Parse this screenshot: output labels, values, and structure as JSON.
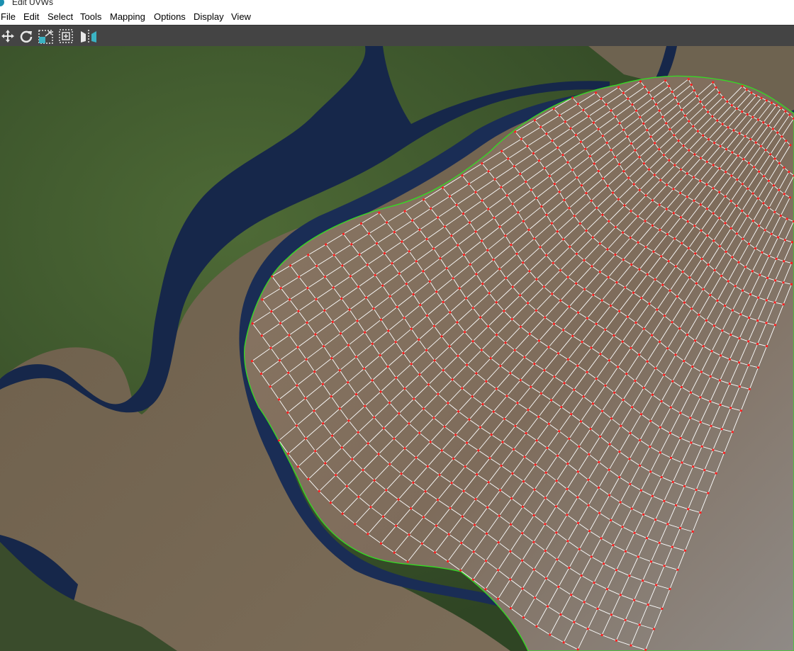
{
  "window": {
    "title": "Edit UVWs",
    "app_icon": "3dsmax-app-icon"
  },
  "menu": {
    "items": [
      {
        "label": "File"
      },
      {
        "label": "Edit"
      },
      {
        "label": "Select"
      },
      {
        "label": "Tools"
      },
      {
        "label": "Mapping"
      },
      {
        "label": "Options"
      },
      {
        "label": "Display"
      },
      {
        "label": "View"
      }
    ]
  },
  "toolbar": {
    "tools": [
      {
        "icon": "move-icon",
        "name": "move-tool"
      },
      {
        "icon": "rotate-icon",
        "name": "rotate-tool"
      },
      {
        "icon": "scale-icon",
        "name": "scale-tool"
      },
      {
        "icon": "freeform-icon",
        "name": "freeform-tool"
      },
      {
        "icon": "mirror-icon",
        "name": "mirror-tool"
      }
    ]
  },
  "viewport": {
    "description_colors": {
      "land_green": "#3f5430",
      "land_brown": "#7a6a55",
      "water": "#16274a",
      "grid_lines": "#ffffff",
      "border_edge": "#33dd22",
      "vertex": "#ff2020"
    }
  }
}
